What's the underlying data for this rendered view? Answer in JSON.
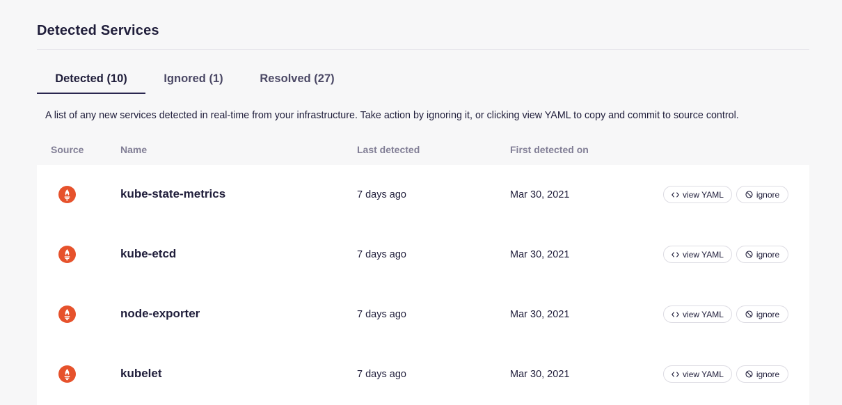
{
  "page": {
    "title": "Detected Services"
  },
  "tabs": [
    {
      "label": "Detected (10)",
      "active": true
    },
    {
      "label": "Ignored (1)",
      "active": false
    },
    {
      "label": "Resolved (27)",
      "active": false
    }
  ],
  "description": "A list of any new services detected in real-time from your infrastructure. Take action by ignoring it, or clicking view YAML to copy and commit to source control.",
  "table": {
    "headers": {
      "source": "Source",
      "name": "Name",
      "last_detected": "Last detected",
      "first_detected": "First detected on"
    },
    "rows": [
      {
        "source_icon": "prometheus-icon",
        "name": "kube-state-metrics",
        "last_detected": "7 days ago",
        "first_detected": "Mar 30, 2021"
      },
      {
        "source_icon": "prometheus-icon",
        "name": "kube-etcd",
        "last_detected": "7 days ago",
        "first_detected": "Mar 30, 2021"
      },
      {
        "source_icon": "prometheus-icon",
        "name": "node-exporter",
        "last_detected": "7 days ago",
        "first_detected": "Mar 30, 2021"
      },
      {
        "source_icon": "prometheus-icon",
        "name": "kubelet",
        "last_detected": "7 days ago",
        "first_detected": "Mar 30, 2021"
      }
    ],
    "actions": {
      "view_yaml": "view YAML",
      "ignore": "ignore"
    }
  },
  "colors": {
    "accent": "#2a2750",
    "prometheus": "#e6522c",
    "background": "#f7f7f8"
  }
}
